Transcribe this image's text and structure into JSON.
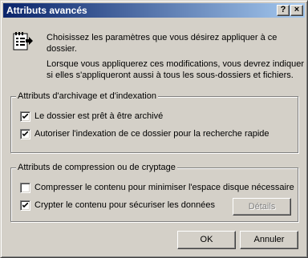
{
  "window": {
    "title": "Attributs avancés",
    "help_button": "?",
    "close_button": "×"
  },
  "intro": {
    "line1": "Choisissez les paramètres que vous désirez appliquer à ce",
    "line2": "dossier.",
    "line3": "Lorsque vous appliquerez ces modifications, vous devrez indiquer",
    "line4": "si elles s'appliqueront aussi à tous les sous-dossiers et fichiers."
  },
  "archive_group": {
    "label": "Attributs d'archivage et d'indexation",
    "items": [
      {
        "label": "Le dossier est prêt à être archivé",
        "checked": true
      },
      {
        "label": "Autoriser l'indexation de ce dossier pour la recherche rapide",
        "checked": true
      }
    ]
  },
  "compress_group": {
    "label": "Attributs de compression ou de cryptage",
    "items": [
      {
        "label": "Compresser le contenu pour minimiser l'espace disque nécessaire",
        "checked": false
      },
      {
        "label": "Crypter le contenu pour sécuriser les données",
        "checked": true
      }
    ],
    "details_button": "Détails"
  },
  "buttons": {
    "ok": "OK",
    "cancel": "Annuler"
  }
}
